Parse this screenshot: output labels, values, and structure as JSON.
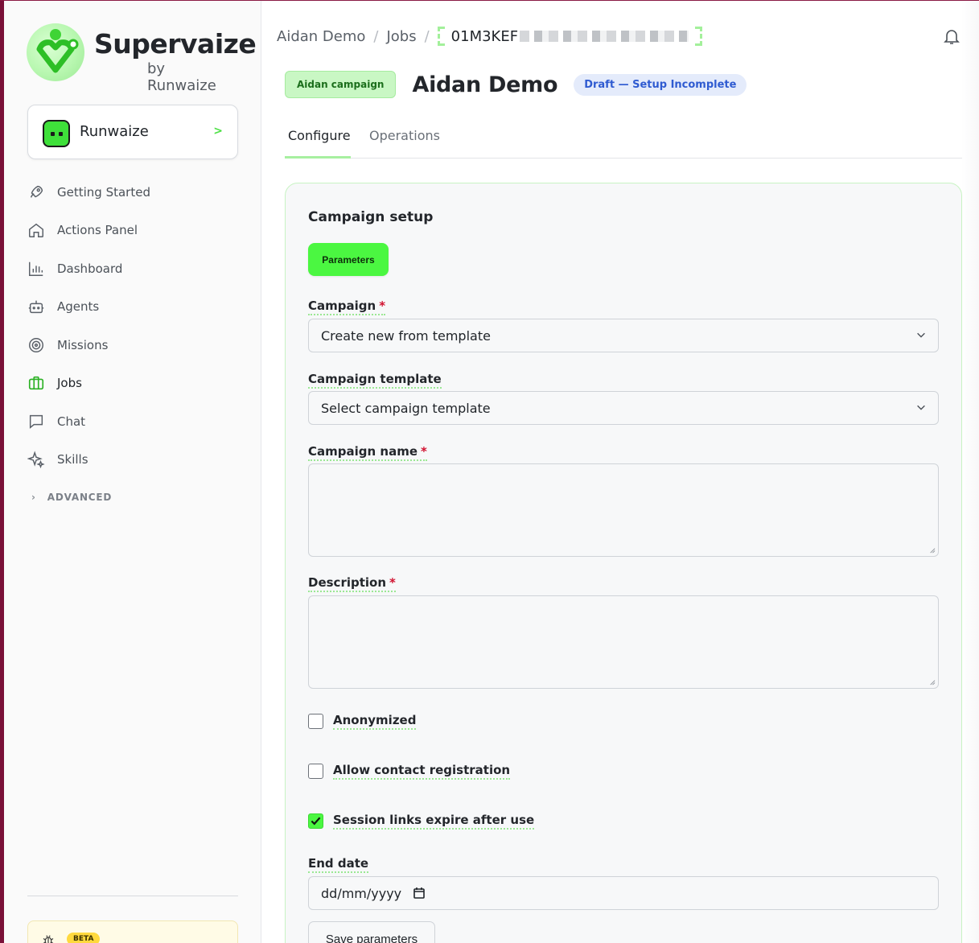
{
  "brand": {
    "title": "Supervaize",
    "subtitle": "by Runwaize",
    "accent": "#4bf741"
  },
  "org": {
    "name": "Runwaize"
  },
  "nav": {
    "items": [
      {
        "label": "Getting Started",
        "icon": "rocket-icon"
      },
      {
        "label": "Actions Panel",
        "icon": "home-icon"
      },
      {
        "label": "Dashboard",
        "icon": "bar-chart-icon"
      },
      {
        "label": "Agents",
        "icon": "robot-icon"
      },
      {
        "label": "Missions",
        "icon": "target-icon"
      },
      {
        "label": "Jobs",
        "icon": "briefcase-icon",
        "active": true
      },
      {
        "label": "Chat",
        "icon": "chat-icon"
      },
      {
        "label": "Skills",
        "icon": "sparkles-icon"
      }
    ],
    "advanced": "ADVANCED"
  },
  "beta": {
    "badge": "BETA"
  },
  "breadcrumb": {
    "root": "Aidan Demo",
    "section": "Jobs",
    "id": "01M3KEF"
  },
  "header": {
    "campaign_tag": "Aidan campaign",
    "title": "Aidan Demo",
    "status": "Draft — Setup Incomplete"
  },
  "tabs": [
    {
      "label": "Configure",
      "active": true
    },
    {
      "label": "Operations",
      "active": false
    }
  ],
  "panel": {
    "title": "Campaign setup",
    "parameters_button": "Parameters",
    "fields": {
      "campaign": {
        "label": "Campaign",
        "required": "*",
        "value": "Create new from template"
      },
      "template": {
        "label": "Campaign template",
        "value": "Select campaign template"
      },
      "name": {
        "label": "Campaign name",
        "required": "*",
        "value": ""
      },
      "description": {
        "label": "Description",
        "required": "*",
        "value": ""
      },
      "end_date": {
        "label": "End date",
        "placeholder": "dd/mm/yyyy"
      }
    },
    "checkboxes": [
      {
        "label": "Anonymized",
        "checked": false
      },
      {
        "label": "Allow contact registration",
        "checked": false
      },
      {
        "label": "Session links expire after use",
        "checked": true
      }
    ],
    "save_button": "Save parameters"
  }
}
